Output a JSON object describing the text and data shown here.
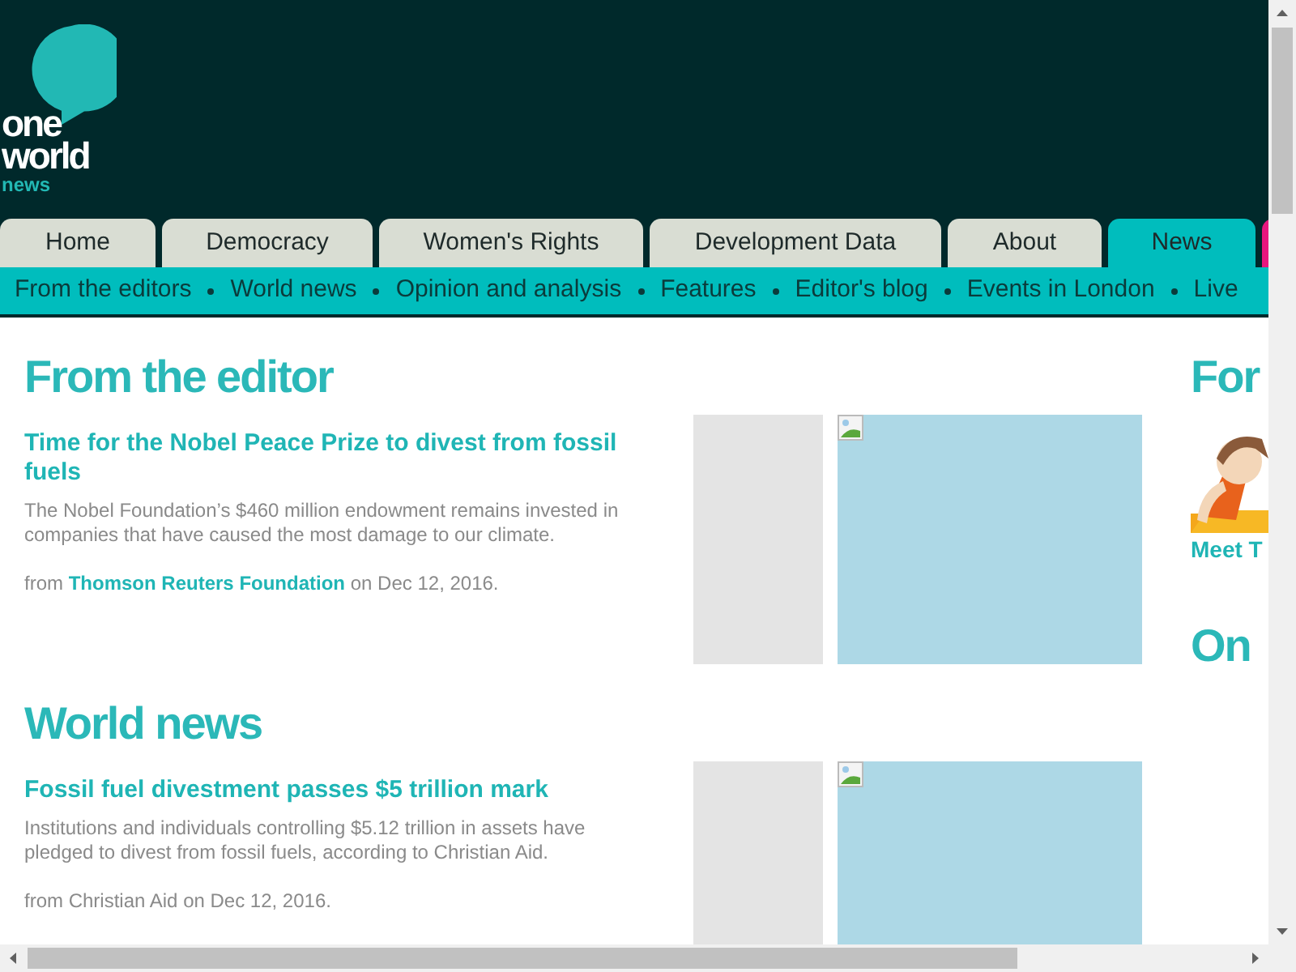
{
  "logo": {
    "line1": "one",
    "line2": "world",
    "line3": "news"
  },
  "tabs": [
    {
      "label": "Home",
      "selected": false
    },
    {
      "label": "Democracy",
      "selected": false
    },
    {
      "label": "Women's Rights",
      "selected": false
    },
    {
      "label": "Development Data",
      "selected": false
    },
    {
      "label": "About",
      "selected": false
    },
    {
      "label": "News",
      "selected": true
    }
  ],
  "subnav": [
    "From the editors",
    "World news",
    "Opinion and analysis",
    "Features",
    "Editor's blog",
    "Events in London",
    "Live"
  ],
  "sections": [
    {
      "title": "From the editor",
      "articles": [
        {
          "title": "Time for the Nobel Peace Prize to divest from fossil fuels",
          "summary": "The Nobel Foundation’s $460 million endowment remains invested in companies that have caused the most damage to our climate.",
          "from_label": "from",
          "source": "Thomson Reuters Foundation",
          "source_linked": true,
          "date": "on Dec 12, 2016."
        }
      ]
    },
    {
      "title": "World news",
      "articles": [
        {
          "title": "Fossil fuel divestment passes $5 trillion mark",
          "summary": "Institutions and individuals controlling $5.12 trillion in assets have pledged to divest from fossil fuels, according to Christian Aid.",
          "from_label": "from",
          "source": "Christian Aid",
          "source_linked": false,
          "date": "on Dec 12, 2016."
        }
      ]
    }
  ],
  "sidebar": {
    "title": "For",
    "caption": "Meet T",
    "title2": "On"
  }
}
